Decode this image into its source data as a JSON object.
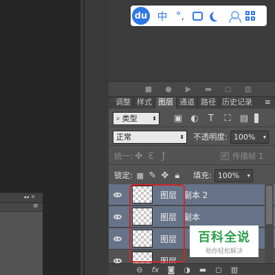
{
  "ime_toolbar": {
    "logo": "du",
    "items": [
      {
        "id": "lang",
        "label": "中"
      },
      {
        "id": "punct",
        "label": "°,"
      }
    ],
    "icons": [
      "toolbox-icon",
      "moon-icon",
      "user-icon",
      "grid-icon"
    ],
    "accent_color": "#2f77e6"
  },
  "panel_tabs": [
    "调整",
    "样式",
    "图层",
    "通道",
    "路径",
    "历史记录"
  ],
  "active_tab": "图层",
  "filter": {
    "label": "类型"
  },
  "blend": {
    "mode": "正常",
    "opacity_label": "不透明度:",
    "opacity_value": "100%"
  },
  "unify": {
    "label": "统一:",
    "propagate_label": "传播帧 1",
    "propagate_checked": true
  },
  "lock": {
    "label": "锁定:",
    "fill_label": "填充:",
    "fill_value": "100%"
  },
  "layers": [
    {
      "name": "图层 4 副本 2",
      "name_visible": "图层",
      "suffix": "副本 2",
      "selected": true
    },
    {
      "name": "图层 4 副本",
      "name_visible": "图层",
      "suffix": "副本",
      "selected": true
    },
    {
      "name": "图层 4",
      "name_visible": "图层",
      "suffix": "",
      "selected": true
    },
    {
      "name": "图层",
      "name_visible": "图层",
      "suffix": "",
      "selected": false
    }
  ],
  "watermark": {
    "title": "百科全说",
    "subtitle": "助你轻松解决"
  },
  "bottom_icons": [
    "link-icon",
    "fx-icon",
    "mask-icon",
    "adjustment-icon",
    "folder-icon",
    "new-layer-icon",
    "trash-icon"
  ],
  "highlight_color": "#d0262a"
}
